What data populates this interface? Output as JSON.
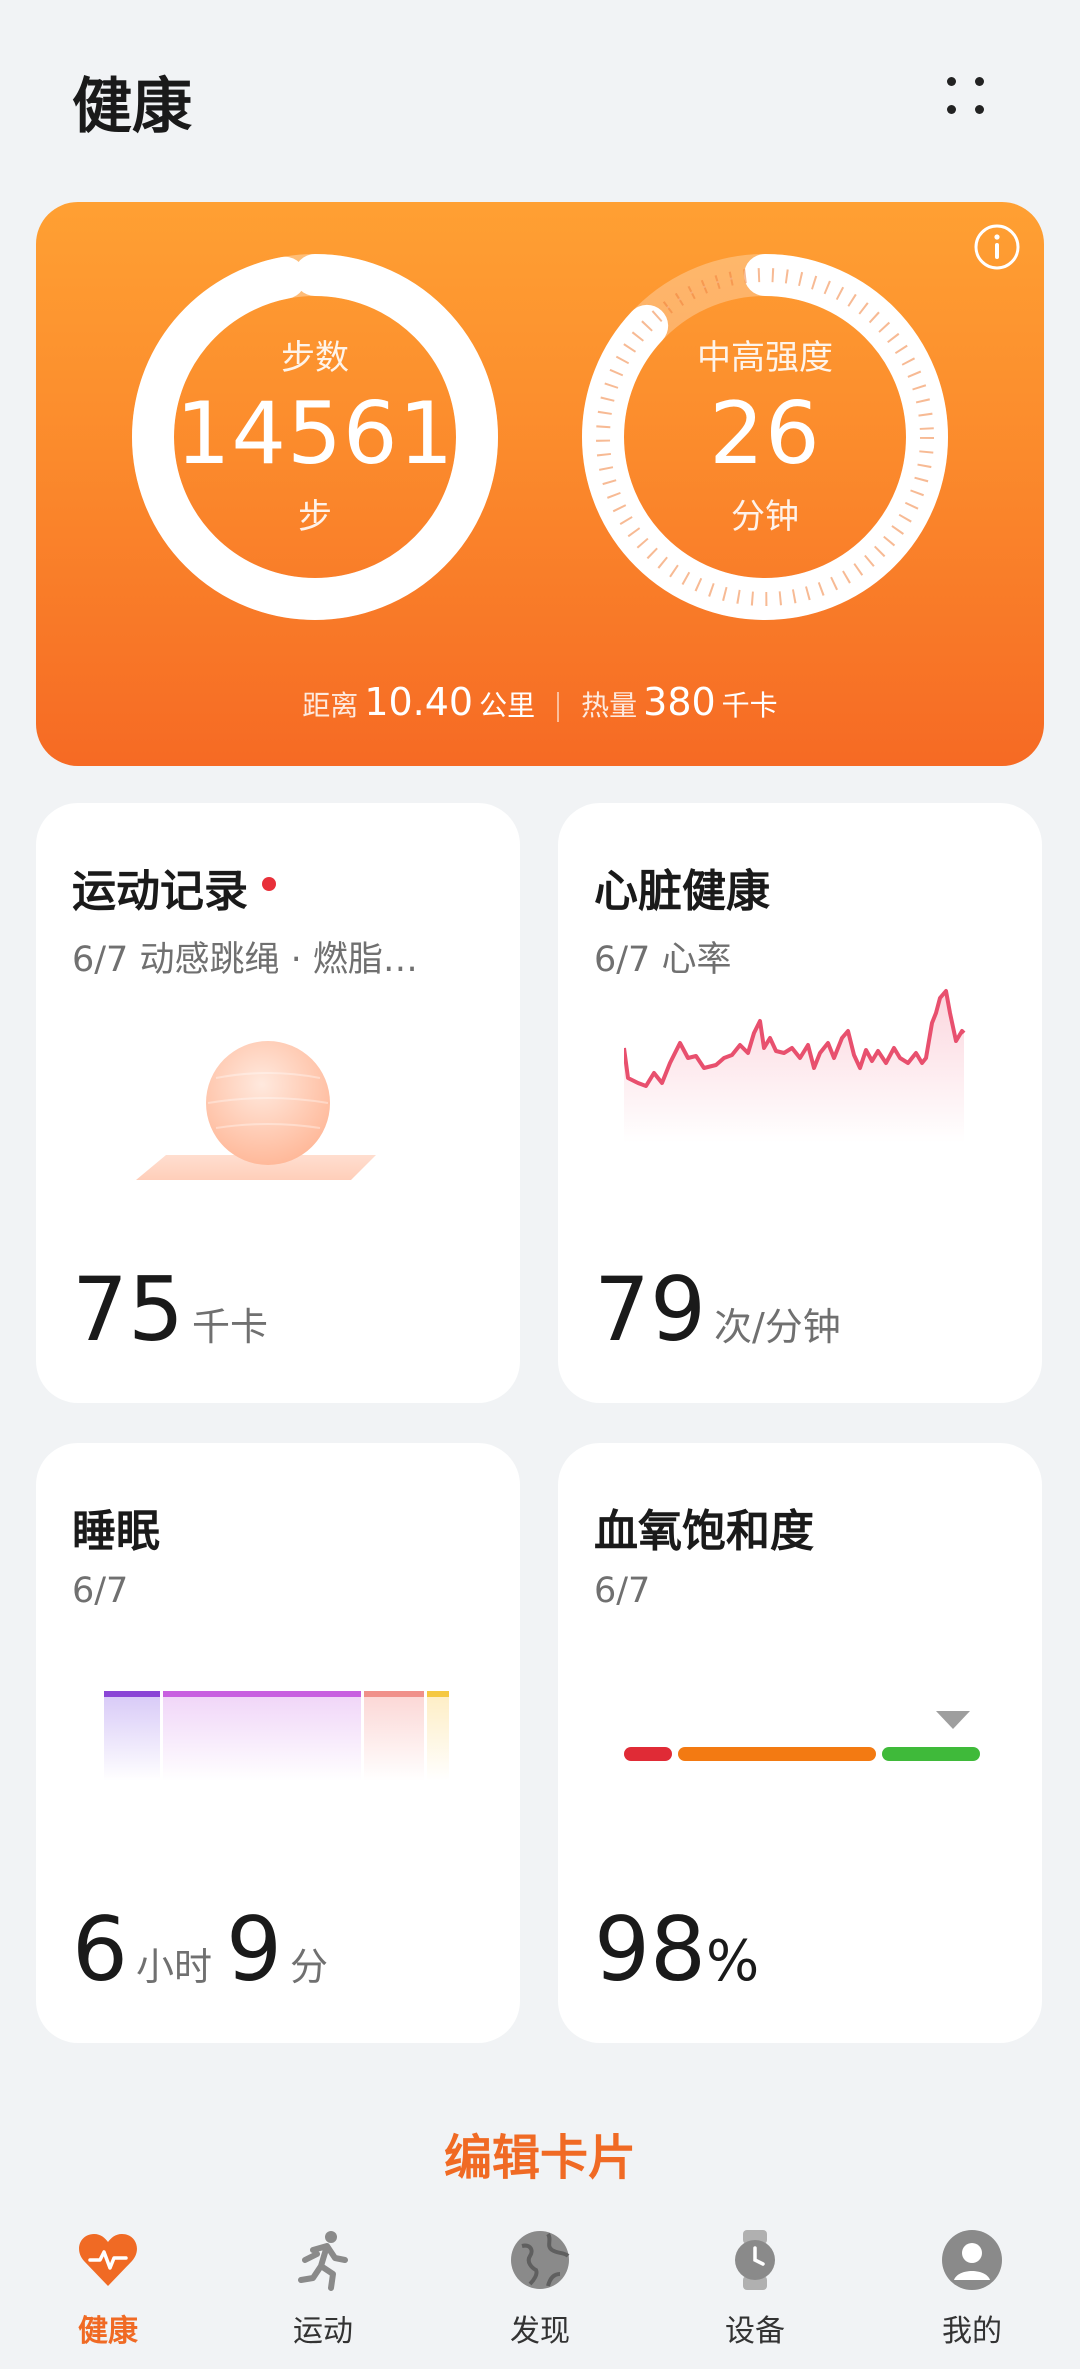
{
  "header": {
    "title": "健康"
  },
  "summary": {
    "steps": {
      "label": "步数",
      "value": "14561",
      "unit": "步",
      "progress": 0.97
    },
    "intensity": {
      "label": "中高强度",
      "value": "26",
      "unit": "分钟",
      "progress": 0.87
    },
    "distance": {
      "label": "距离",
      "value": "10.40",
      "unit": "公里"
    },
    "calories": {
      "label": "热量",
      "value": "380",
      "unit": "千卡"
    }
  },
  "cards": {
    "exercise": {
      "title": "运动记录",
      "subtitle": "6/7 动感跳绳 · 燃脂…",
      "value": "75",
      "unit": "千卡"
    },
    "heart": {
      "title": "心脏健康",
      "subtitle": "6/7 心率",
      "value": "79",
      "unit": "次/分钟"
    },
    "sleep": {
      "title": "睡眠",
      "subtitle": "6/7",
      "hours": "6",
      "hours_unit": "小时",
      "minutes": "9",
      "minutes_unit": "分"
    },
    "spo2": {
      "title": "血氧饱和度",
      "subtitle": "6/7",
      "value": "98",
      "unit": "%"
    }
  },
  "edit_label": "编辑卡片",
  "tabs": [
    {
      "label": "健康",
      "icon": "heart-pulse-icon",
      "active": true
    },
    {
      "label": "运动",
      "icon": "running-icon",
      "active": false
    },
    {
      "label": "发现",
      "icon": "globe-icon",
      "active": false
    },
    {
      "label": "设备",
      "icon": "watch-icon",
      "active": false
    },
    {
      "label": "我的",
      "icon": "user-icon",
      "active": false
    }
  ],
  "colors": {
    "accent": "#f06a24",
    "heart_line": "#e8506e",
    "card_bg": "#ffffff"
  }
}
